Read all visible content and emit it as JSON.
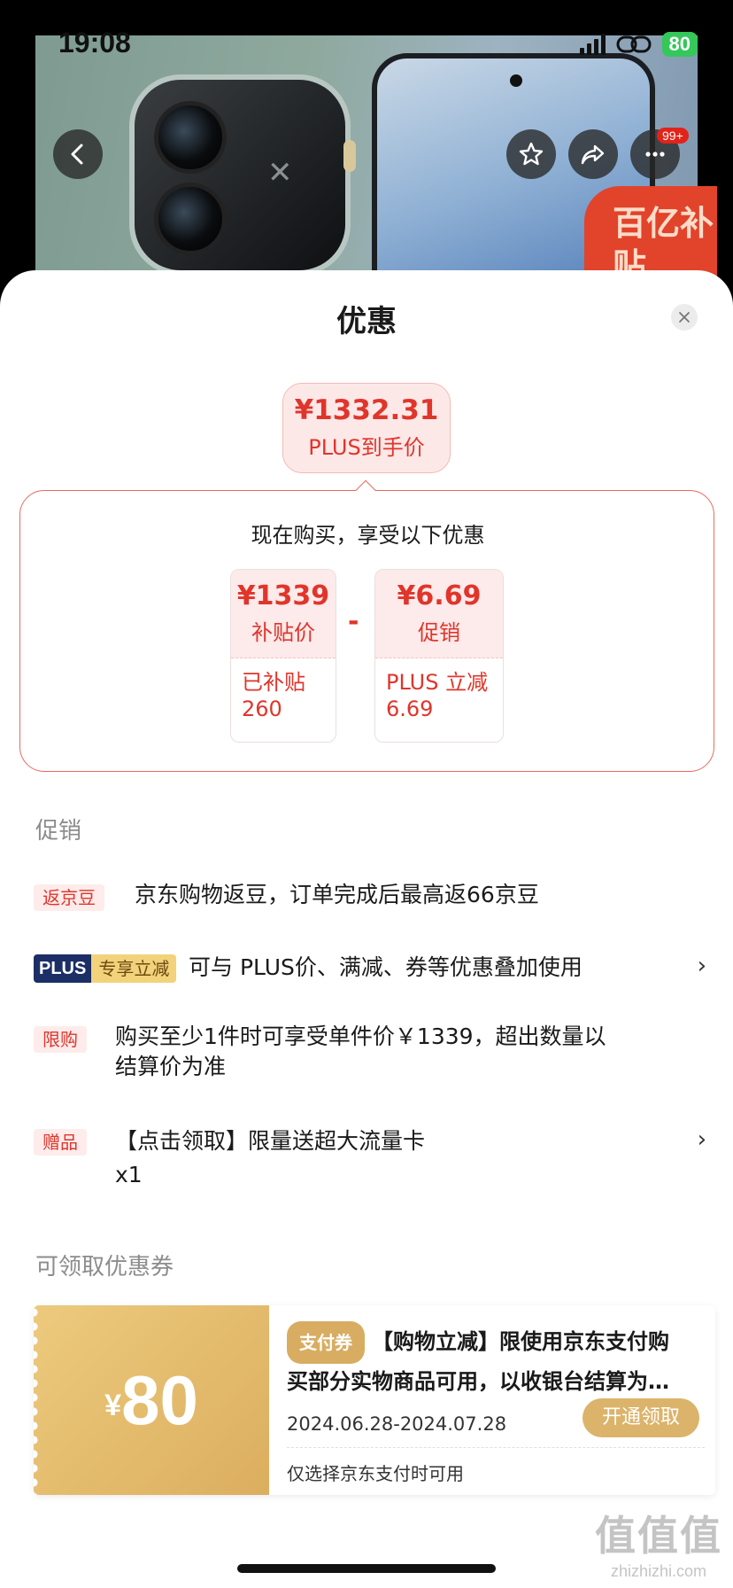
{
  "status_bar": {
    "time": "19:08",
    "battery": "80"
  },
  "product_header": {
    "badge_text": "百亿补贴",
    "more_badge": "99+"
  },
  "sheet": {
    "title": "优惠"
  },
  "final_price": {
    "price": "¥1332.31",
    "caption": "PLUS到手价"
  },
  "breakdown": {
    "title": "现在购买，享受以下优惠",
    "operator": "-",
    "cards": [
      {
        "value": "¥1339",
        "label": "补贴价",
        "detail_line1": "已补贴",
        "detail_line2": "260"
      },
      {
        "value": "¥6.69",
        "label": "促销",
        "detail_line1": "PLUS 立减",
        "detail_line2": "6.69"
      }
    ]
  },
  "promotions": {
    "section_title": "促销",
    "items": [
      {
        "tag": "返京豆",
        "text": "京东购物返豆，订单完成后最高返66京豆"
      },
      {
        "tag_part1": "PLUS",
        "tag_part2": "专享立减",
        "text": "可与 PLUS价、满减、券等优惠叠加使用",
        "chevron": "›"
      },
      {
        "tag": "限购",
        "text_line1": "购买至少1件时可享受单件价￥1339，超出数量以",
        "text_line2": "结算价为准"
      },
      {
        "tag": "赠品",
        "text_line1": "【点击领取】限量送超大流量卡",
        "text_line2": "x1",
        "chevron": "›"
      }
    ]
  },
  "coupons": {
    "section_title": "可领取优惠券",
    "items": [
      {
        "currency": "¥",
        "amount": "80",
        "chip": "支付券",
        "desc_line1": "【购物立减】限使用京东支付购",
        "desc_line2": "买部分实物商品可用，以收银台结算为…",
        "date_range": "2024.06.28-2024.07.28",
        "claim_label": "开通领取",
        "note": "仅选择京东支付时可用"
      }
    ]
  },
  "watermark": {
    "line1": "值值值",
    "line2": "zhizhizhi.com"
  },
  "colors": {
    "accent_red": "#e0352b",
    "coupon_gold": "#dcb36b",
    "plus_navy": "#1c2e66"
  }
}
